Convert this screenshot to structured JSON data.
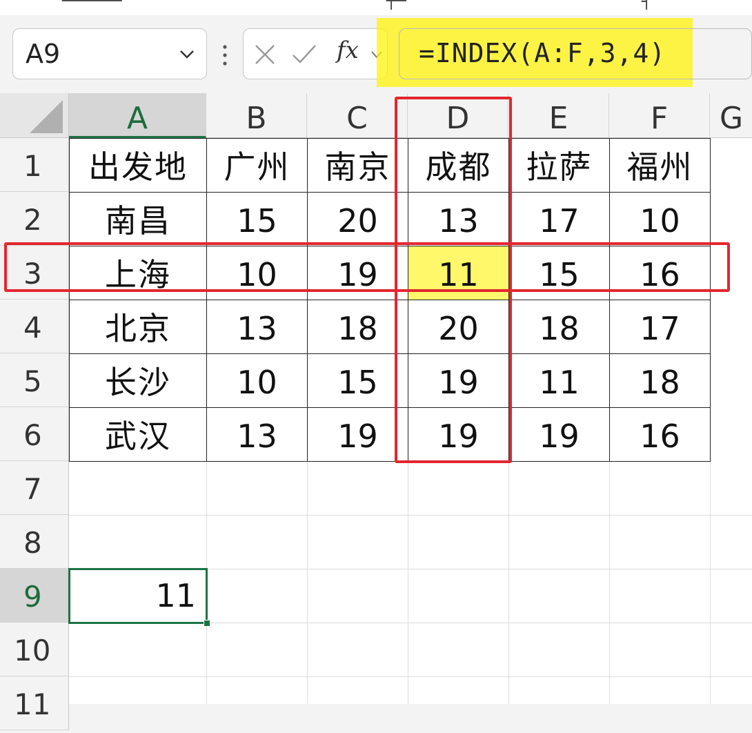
{
  "name_box": {
    "value": "A9"
  },
  "formula_bar": {
    "fx_label": "fx",
    "formula": "=INDEX(A:F,3,4)"
  },
  "columns": [
    "A",
    "B",
    "C",
    "D",
    "E",
    "F",
    "G"
  ],
  "rows": [
    "1",
    "2",
    "3",
    "4",
    "5",
    "6",
    "7",
    "8",
    "9",
    "10",
    "11"
  ],
  "table": [
    [
      "出发地",
      "广州",
      "南京",
      "成都",
      "拉萨",
      "福州"
    ],
    [
      "南昌",
      "15",
      "20",
      "13",
      "17",
      "10"
    ],
    [
      "上海",
      "10",
      "19",
      "11",
      "15",
      "16"
    ],
    [
      "北京",
      "13",
      "18",
      "20",
      "18",
      "17"
    ],
    [
      "长沙",
      "10",
      "15",
      "19",
      "11",
      "18"
    ],
    [
      "武汉",
      "13",
      "19",
      "19",
      "19",
      "16"
    ]
  ],
  "active_cell": {
    "ref": "A9",
    "value": "11"
  },
  "highlighted_cell": "D3",
  "colors": {
    "annotation_red": "#e3262f",
    "highlight_yellow": "#fff200",
    "active_green": "#1b7345"
  }
}
